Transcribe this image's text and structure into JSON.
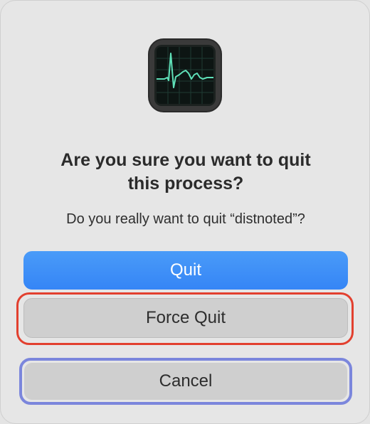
{
  "dialog": {
    "icon": "activity-monitor-icon",
    "title_line1": "Are you sure you want to quit",
    "title_line2": "this process?",
    "message": "Do you really want to quit “distnoted”?",
    "quit_label": "Quit",
    "force_quit_label": "Force Quit",
    "cancel_label": "Cancel"
  },
  "colors": {
    "quit_button": "#3a8cf7",
    "force_quit_highlight": "#e2402f",
    "cancel_focus_ring": "#7b86dc",
    "monitor_trace": "#5fe0b8"
  }
}
